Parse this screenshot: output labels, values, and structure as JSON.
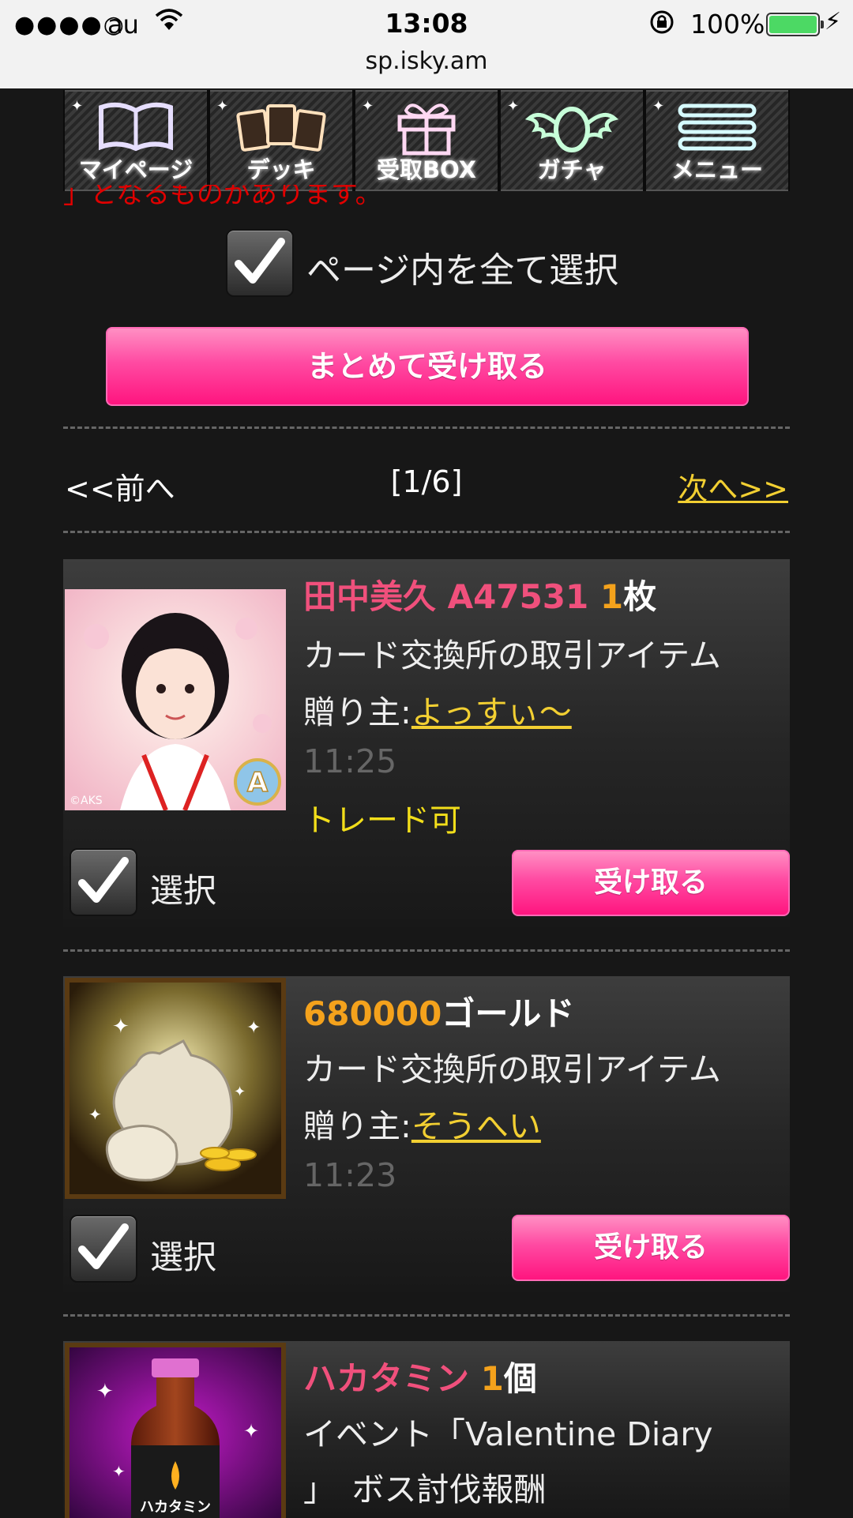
{
  "status_bar": {
    "signal": "●●●●○",
    "carrier": "au",
    "time": "13:08",
    "battery": "100%",
    "url": "sp.isky.am"
  },
  "nav": {
    "items": [
      {
        "label": "マイページ",
        "icon": "book-icon",
        "color": "#b6a6ff"
      },
      {
        "label": "デッキ",
        "icon": "cards-icon",
        "color": "#f6c48a"
      },
      {
        "label": "受取BOX",
        "icon": "gift-icon",
        "color": "#ff88d6"
      },
      {
        "label": "ガチャ",
        "icon": "gacha-icon",
        "color": "#58f09a"
      },
      {
        "label": "メニュー",
        "icon": "menu-icon",
        "color": "#66e0f0"
      }
    ]
  },
  "warning": "」となるものがあります。",
  "select_all_label": "ページ内を全て選択",
  "receive_all_button": "まとめて受け取る",
  "pager": {
    "prev": "<<前へ",
    "count": "[1/6]",
    "next": "次へ>>"
  },
  "items": [
    {
      "name": "田中美久 A47531",
      "qty": "1",
      "unit": "枚",
      "desc": "カード交換所の取引アイテム",
      "sender_prefix": "贈り主:",
      "sender": "よっすぃ〜",
      "time": "11:25",
      "trade": "トレード可",
      "select_label": "選択",
      "receive_label": "受け取る",
      "thumb_copyright": "©AKS",
      "thumb_badge": "A"
    },
    {
      "amount": "680000",
      "unit": "ゴールド",
      "desc": "カード交換所の取引アイテム",
      "sender_prefix": "贈り主:",
      "sender": "そうへい",
      "time": "11:23",
      "select_label": "選択",
      "receive_label": "受け取る"
    },
    {
      "name": "ハカタミン",
      "qty": "1",
      "unit": "個",
      "desc_line1": "イベント「Valentine Diary",
      "desc_line2": "」　ボス討伐報酬",
      "thumb_label": "ハカタミン"
    }
  ]
}
